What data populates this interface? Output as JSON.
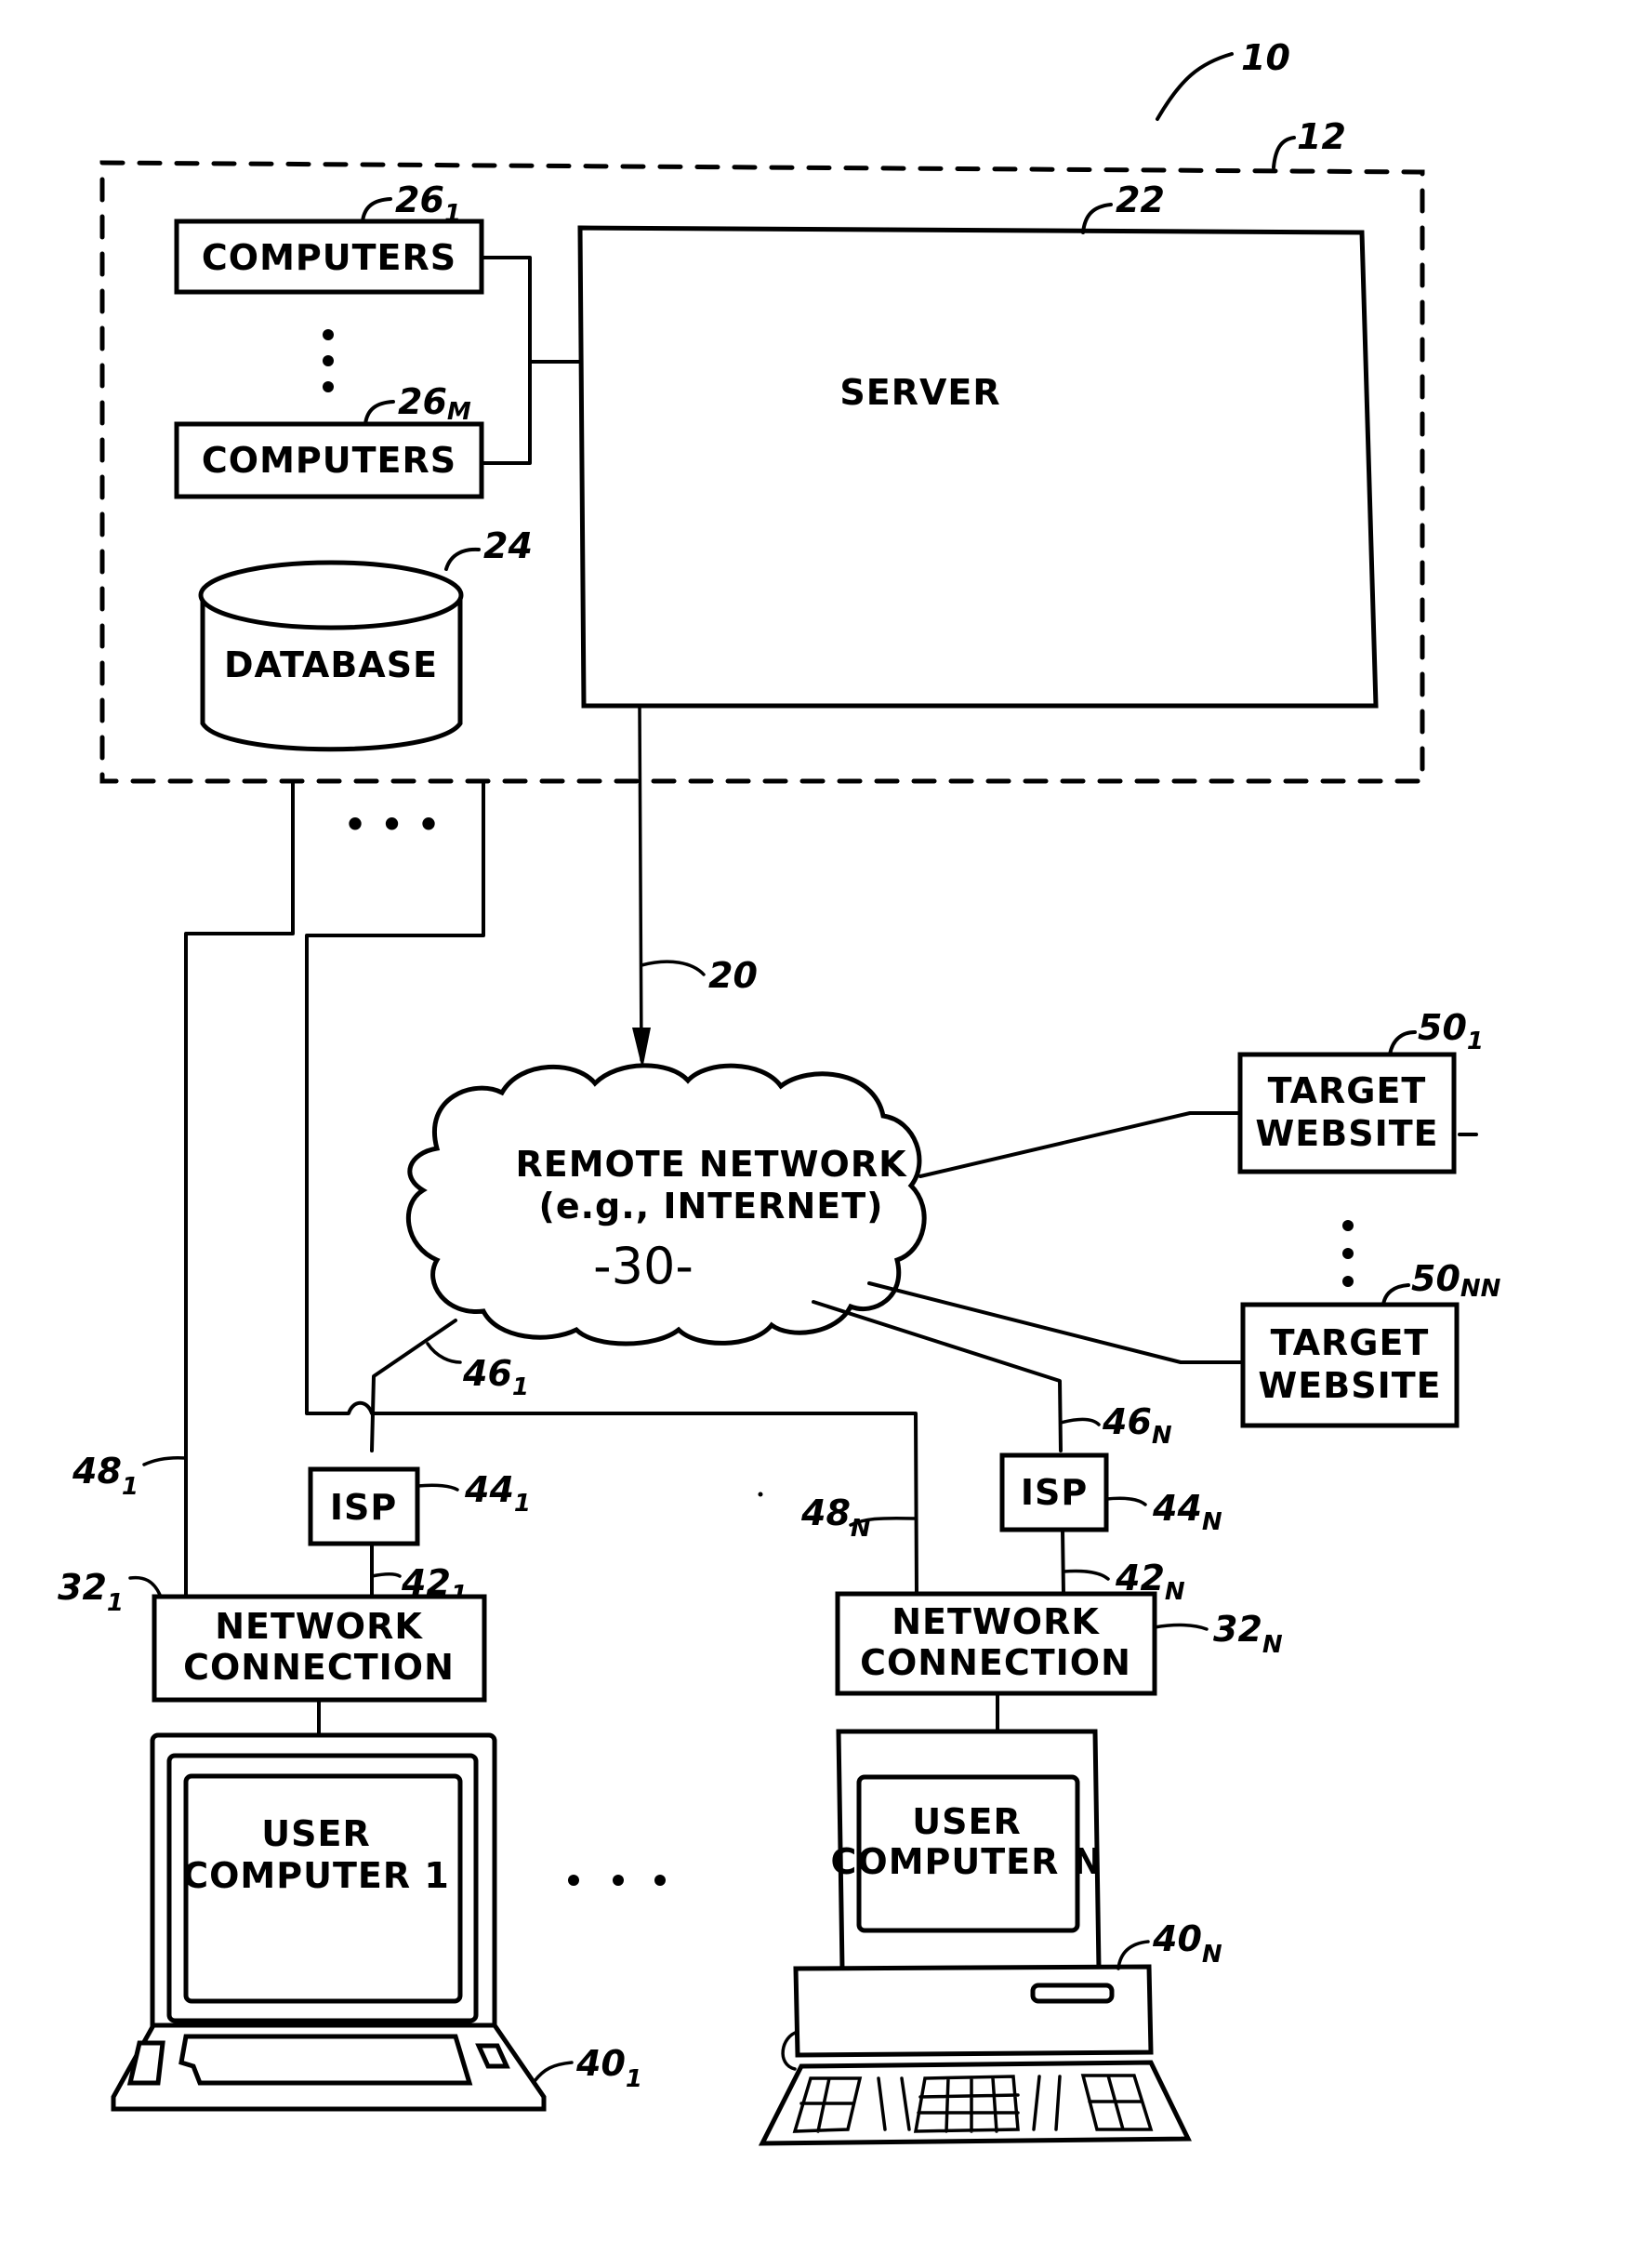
{
  "figure": {
    "ref_system": "10",
    "ref_facility": "12",
    "server": {
      "label": "SERVER",
      "ref": "22"
    },
    "computers": [
      {
        "label": "COMPUTERS",
        "ref": "26",
        "sub": "1"
      },
      {
        "label": "COMPUTERS",
        "ref": "26",
        "sub": "M"
      }
    ],
    "database": {
      "label": "DATABASE",
      "ref": "24"
    },
    "server_link_ref": "20",
    "network": {
      "line1": "REMOTE NETWORK",
      "line2": "(e.g., INTERNET)",
      "ref_handwritten": "-30-"
    },
    "target_websites": [
      {
        "line1": "TARGET",
        "line2": "WEBSITE",
        "ref": "50",
        "sub": "1"
      },
      {
        "line1": "TARGET",
        "line2": "WEBSITE",
        "ref": "50",
        "sub": "NN"
      }
    ],
    "isps": [
      {
        "label": "ISP",
        "ref": "44",
        "sub": "1",
        "up_ref": "46",
        "up_sub": "1",
        "down_ref": "42",
        "down_sub": "1"
      },
      {
        "label": "ISP",
        "ref": "44",
        "sub": "N",
        "up_ref": "46",
        "up_sub": "N",
        "down_ref": "42",
        "down_sub": "N"
      }
    ],
    "direct_links": [
      {
        "ref": "48",
        "sub": "1"
      },
      {
        "ref": "48",
        "sub": "N"
      }
    ],
    "network_connections": [
      {
        "line1": "NETWORK",
        "line2": "CONNECTION",
        "ref": "32",
        "sub": "1"
      },
      {
        "line1": "NETWORK",
        "line2": "CONNECTION",
        "ref": "32",
        "sub": "N"
      }
    ],
    "user_computers": [
      {
        "line1": "USER",
        "line2": "COMPUTER 1",
        "ref": "40",
        "sub": "1",
        "type": "laptop"
      },
      {
        "line1": "USER",
        "line2": "COMPUTER N",
        "ref": "40",
        "sub": "N",
        "type": "desktop"
      }
    ],
    "ellipsis": "• • •"
  }
}
